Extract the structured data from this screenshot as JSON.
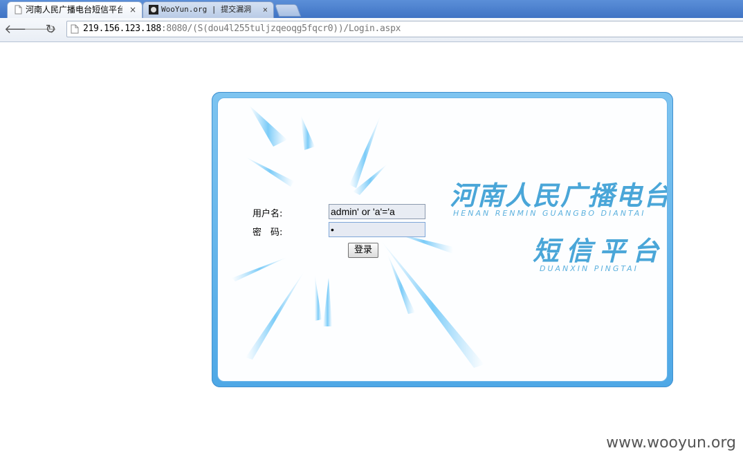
{
  "browser": {
    "tabs": [
      {
        "title": "河南人民广播电台短信平台",
        "active": true
      },
      {
        "title": "WooYun.org | 提交漏洞",
        "active": false
      }
    ],
    "close_glyph": "×",
    "back_glyph": "🡐",
    "forward_glyph": "🡒",
    "reload_glyph": "↻",
    "url_host": "219.156.123.188",
    "url_rest": ":8080/(S(dou4l255tuljzqeoqg5fqcr0))/Login.aspx"
  },
  "login": {
    "username_label": "用户名:",
    "password_label": "密　码:",
    "username_value": "admin' or 'a'='a",
    "password_value": "•",
    "submit_label": "登录"
  },
  "branding": {
    "title": "河南人民广播电台",
    "title_pinyin": "HENAN RENMIN GUANGBO DIANTAI",
    "subtitle": "短信平台",
    "subtitle_pinyin": "DUANXIN PINGTAI"
  },
  "watermark": "www.wooyun.org",
  "colors": {
    "frame": "#4ea8e6",
    "brand_text": "#4aa6d8"
  }
}
